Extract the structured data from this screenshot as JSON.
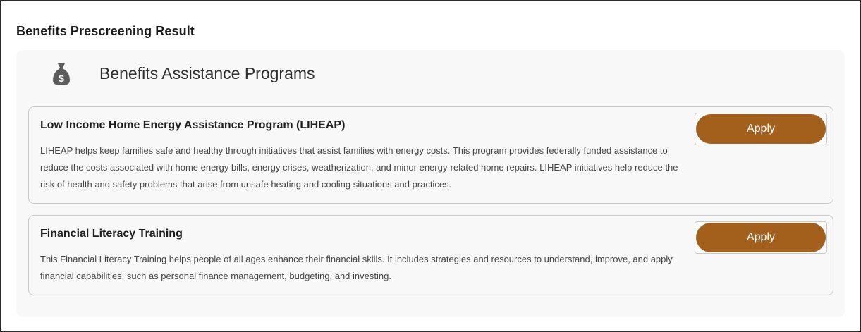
{
  "page": {
    "title": "Benefits Prescreening Result"
  },
  "panel": {
    "icon": "money-bag-icon",
    "title": "Benefits Assistance Programs"
  },
  "programs": [
    {
      "title": "Low Income Home Energy Assistance Program (LIHEAP)",
      "description": "LIHEAP helps keep families safe and healthy through initiatives that assist families with energy costs. This program provides federally funded assistance to reduce the costs associated with home energy bills, energy crises, weatherization, and minor energy-related home repairs. LIHEAP initiatives help reduce the risk of health and safety problems that arise from unsafe heating and cooling situations and practices.",
      "apply_label": "Apply"
    },
    {
      "title": "Financial Literacy Training",
      "description": "This Financial Literacy Training helps people of all ages enhance their financial skills. It includes strategies and resources to understand, improve, and apply financial capabilities, such as personal finance management, budgeting, and investing.",
      "apply_label": "Apply"
    }
  ],
  "colors": {
    "accent": "#a3601d",
    "icon": "#5c5c5c",
    "panel_bg": "#f8f8f8",
    "card_border": "#c9c9c9"
  }
}
